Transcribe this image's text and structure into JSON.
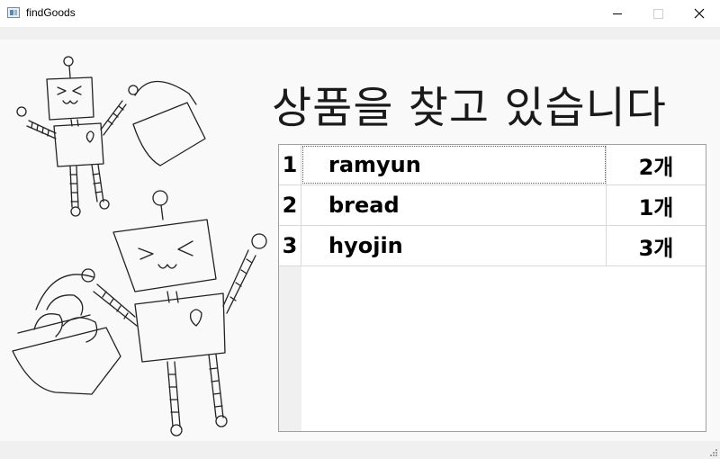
{
  "window": {
    "title": "findGoods",
    "icon": "app-window-icon",
    "controls": [
      "minimize-icon",
      "maximize-icon",
      "close-icon"
    ]
  },
  "main": {
    "heading": "상품을 찾고 있습니다",
    "illustration": "robots-carrying-baskets",
    "table": {
      "rows": [
        {
          "num": "1",
          "name": "ramyun",
          "qty": "2개"
        },
        {
          "num": "2",
          "name": "bread",
          "qty": "1개"
        },
        {
          "num": "3",
          "name": "hyojin",
          "qty": "3개"
        }
      ],
      "selected_row": 1
    }
  },
  "colors": {
    "background": "#f9f9f9",
    "border": "#a0a0a0",
    "text": "#1a1a1a"
  }
}
